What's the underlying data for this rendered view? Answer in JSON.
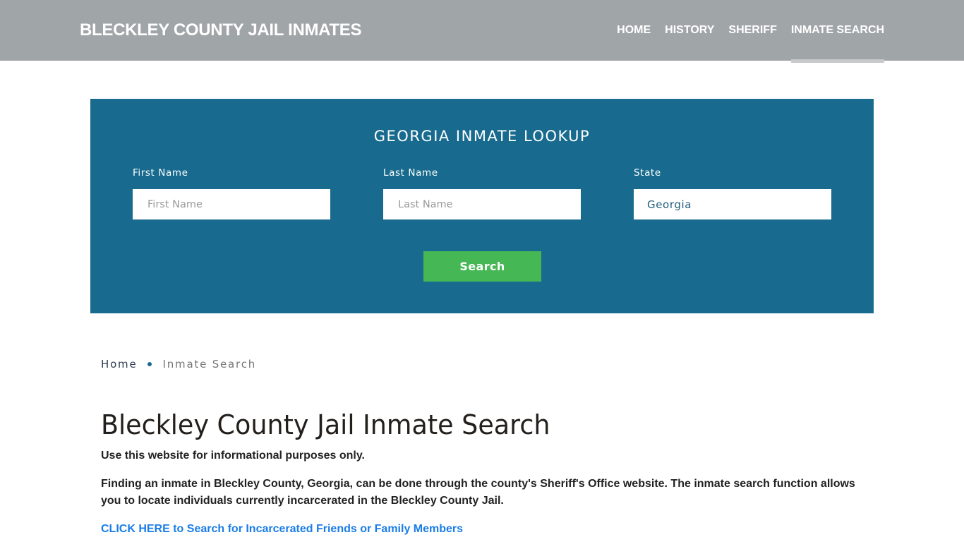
{
  "header": {
    "brand": "BLECKLEY COUNTY JAIL INMATES",
    "nav": [
      {
        "label": "HOME",
        "active": false
      },
      {
        "label": "HISTORY",
        "active": false
      },
      {
        "label": "SHERIFF",
        "active": false
      },
      {
        "label": "INMATE SEARCH",
        "active": true
      }
    ]
  },
  "lookup": {
    "title": "GEORGIA INMATE LOOKUP",
    "first_name": {
      "label": "First Name",
      "placeholder": "First Name",
      "value": ""
    },
    "last_name": {
      "label": "Last Name",
      "placeholder": "Last Name",
      "value": ""
    },
    "state": {
      "label": "State",
      "selected": "Georgia"
    },
    "search_label": "Search"
  },
  "breadcrumb": {
    "home": "Home",
    "current": "Inmate Search"
  },
  "content": {
    "title": "Bleckley County Jail Inmate Search",
    "disclaimer": "Use this website for informational purposes only.",
    "paragraph": "Finding an inmate in Bleckley County, Georgia, can be done through the county's Sheriff's Office website. The inmate search function allows you to locate individuals currently incarcerated in the Bleckley County Jail.",
    "cta_link": "CLICK HERE to Search for Incarcerated Friends or Family Members"
  },
  "colors": {
    "header_bg": "#a0a5a8",
    "lookup_bg": "#186b8e",
    "button_green": "#45b755",
    "link_blue": "#1a7de8"
  }
}
